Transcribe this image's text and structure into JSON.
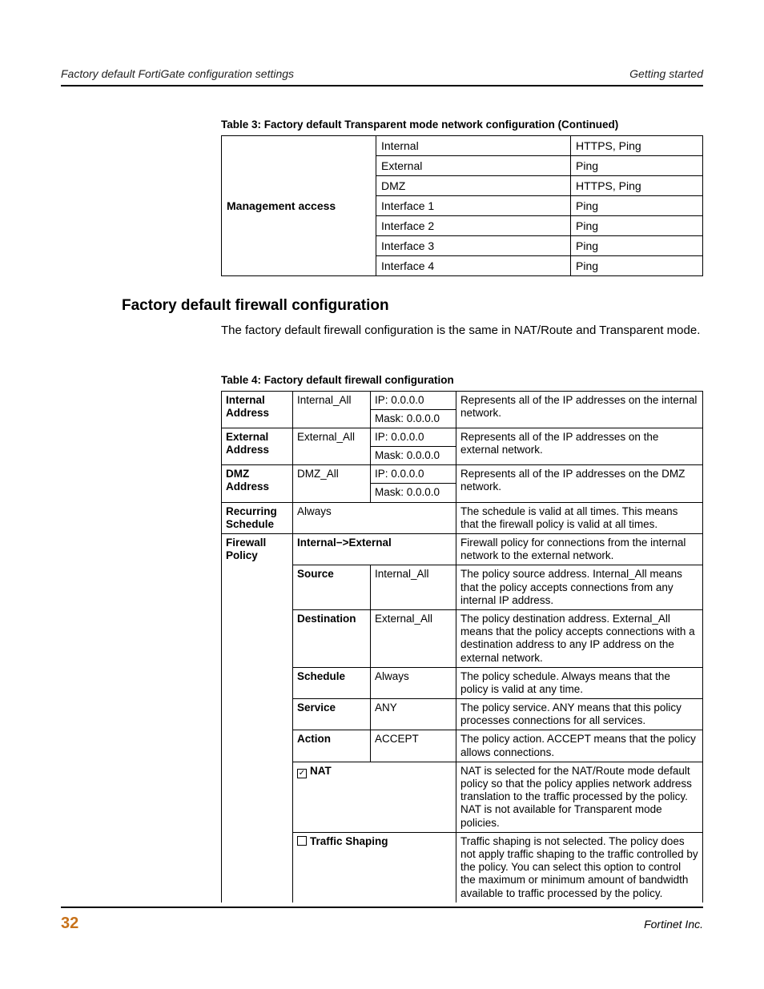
{
  "header": {
    "left": "Factory default FortiGate configuration settings",
    "right": "Getting started"
  },
  "table3": {
    "caption": "Table 3: Factory default Transparent mode network configuration  (Continued)",
    "rowLabel": "Management access",
    "rows": [
      {
        "iface": "Internal",
        "proto": "HTTPS, Ping"
      },
      {
        "iface": "External",
        "proto": "Ping"
      },
      {
        "iface": "DMZ",
        "proto": "HTTPS, Ping"
      },
      {
        "iface": "Interface 1",
        "proto": "Ping"
      },
      {
        "iface": "Interface 2",
        "proto": "Ping"
      },
      {
        "iface": "Interface 3",
        "proto": "Ping"
      },
      {
        "iface": "Interface 4",
        "proto": "Ping"
      }
    ]
  },
  "sectionTitle": "Factory default firewall configuration",
  "sectionBody": "The factory default firewall configuration is the same in NAT/Route and Transparent mode.",
  "table4": {
    "caption": "Table 4: Factory default firewall configuration",
    "internalAddress": {
      "label": "Internal Address",
      "name": "Internal_All",
      "ip": "IP: 0.0.0.0",
      "mask": "Mask: 0.0.0.0",
      "desc": "Represents all of the IP addresses on the internal network."
    },
    "externalAddress": {
      "label": "External Address",
      "name": "External_All",
      "ip": "IP: 0.0.0.0",
      "mask": "Mask: 0.0.0.0",
      "desc": "Represents all of the IP addresses on the external network."
    },
    "dmzAddress": {
      "label": "DMZ Address",
      "name": "DMZ_All",
      "ip": "IP: 0.0.0.0",
      "mask": "Mask: 0.0.0.0",
      "desc": "Represents all of the IP addresses on the DMZ network."
    },
    "recurring": {
      "label": "Recurring Schedule",
      "value": "Always",
      "desc": "The schedule is valid at all times. This means that the firewall policy is valid at all times."
    },
    "firewallPolicy": {
      "label": "Firewall Policy",
      "direction": "Internal−>External",
      "directionDesc": "Firewall policy for connections from the internal network to the external network.",
      "source": {
        "label": "Source",
        "value": "Internal_All",
        "desc": "The policy source address. Internal_All means that the policy accepts connections from any internal IP address."
      },
      "destination": {
        "label": "Destination",
        "value": "External_All",
        "desc": "The policy destination address. External_All means that the policy accepts connections with a destination address to any IP address on the external network."
      },
      "schedule": {
        "label": "Schedule",
        "value": "Always",
        "desc": "The policy schedule. Always means that the policy is valid at any time."
      },
      "service": {
        "label": "Service",
        "value": "ANY",
        "desc": "The policy service. ANY means that this policy processes connections for all services."
      },
      "action": {
        "label": "Action",
        "value": "ACCEPT",
        "desc": "The policy action. ACCEPT means that the policy allows connections."
      },
      "nat": {
        "label": "NAT",
        "checked": true,
        "desc": "NAT is selected for the NAT/Route mode default policy so that the policy applies network address translation to the traffic processed by the policy. NAT is not available for Transparent mode policies."
      },
      "shaping": {
        "label": "Traffic Shaping",
        "checked": false,
        "desc": "Traffic shaping is not selected. The policy does not apply traffic shaping to the traffic controlled by the policy. You can select this option to control the maximum or minimum amount of bandwidth available to traffic processed by the policy."
      }
    }
  },
  "footer": {
    "page": "32",
    "company": "Fortinet Inc."
  }
}
